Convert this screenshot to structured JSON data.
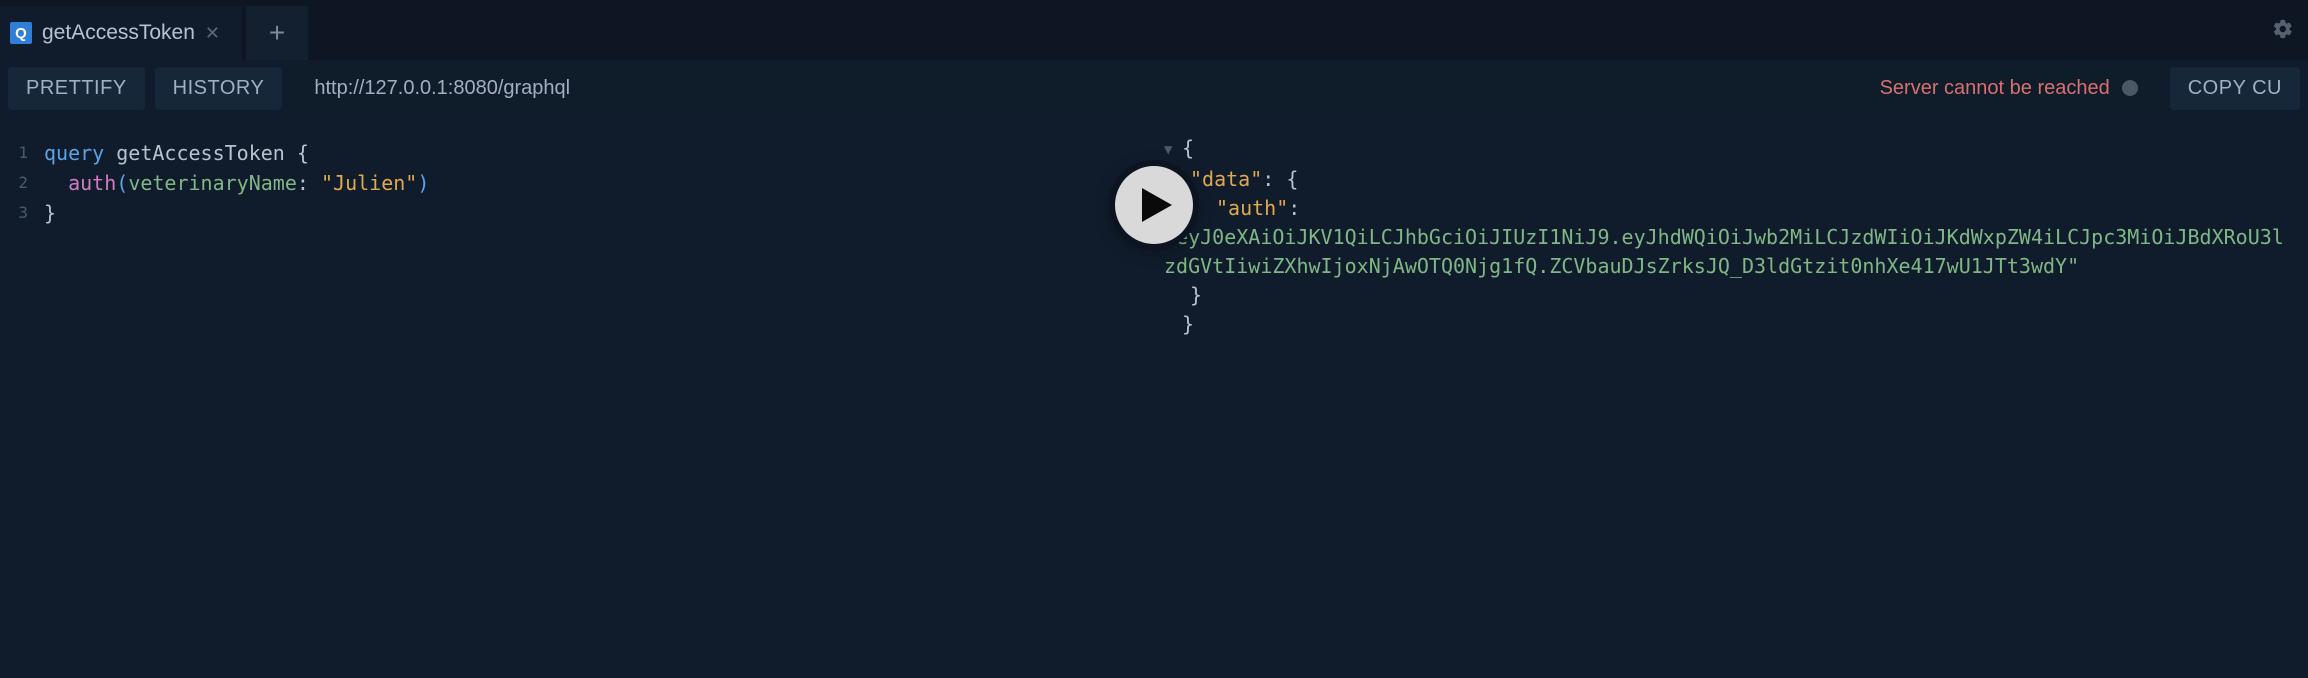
{
  "tab": {
    "badge": "Q",
    "title": "getAccessToken"
  },
  "toolbar": {
    "prettify": "PRETTIFY",
    "history": "HISTORY",
    "copy_curl": "COPY CU",
    "url": "http://127.0.0.1:8080/graphql",
    "server_status": "Server cannot be reached"
  },
  "query": {
    "keyword": "query",
    "opName": "getAccessToken",
    "field": "auth",
    "argName": "veterinaryName",
    "argValue": "\"Julien\""
  },
  "response": {
    "data_key": "\"data\"",
    "auth_key": "\"auth\"",
    "token": "\"eyJ0eXAiOiJKV1QiLCJhbGciOiJIUzI1NiJ9.eyJhdWQiOiJwb2MiLCJzdWIiOiJKdWxpZW4iLCJpc3MiOiJBdXRoU3lzdGVtIiwiZXhwIjoxNjAwOTQ0Njg1fQ.ZCVbauDJsZrksJQ_D3ldGtzit0nhXe417wU1JTt3wdY\""
  },
  "gutter": [
    "1",
    "2",
    "3"
  ]
}
